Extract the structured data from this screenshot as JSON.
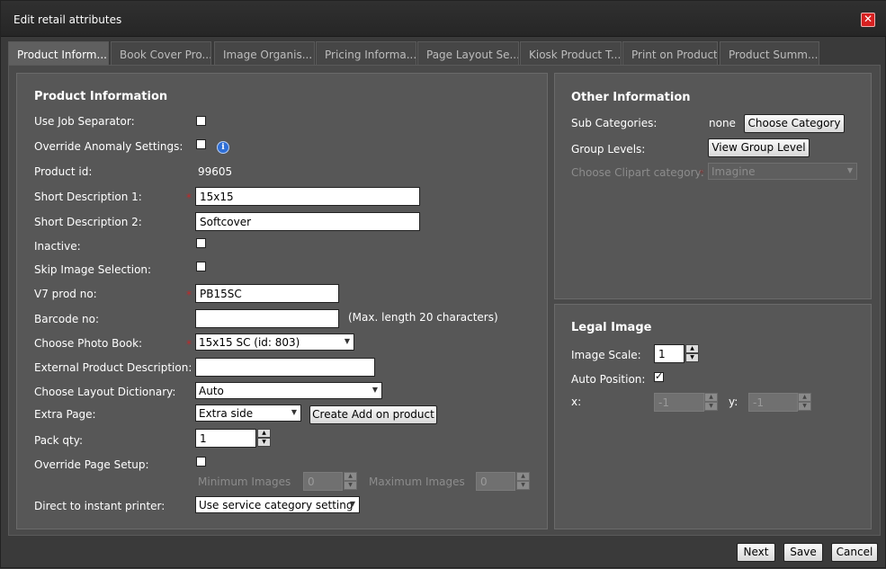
{
  "dialog": {
    "title": "Edit retail attributes"
  },
  "tabs": [
    "Product Inform...",
    "Book Cover Pro...",
    "Image Organis...",
    "Pricing Informa...",
    "Page Layout Se...",
    "Kiosk Product T...",
    "Print on Product",
    "Product Summ..."
  ],
  "product": {
    "heading": "Product Information",
    "use_job_separator": {
      "label": "Use Job Separator:",
      "checked": false
    },
    "override_anomaly": {
      "label": "Override Anomaly Settings:",
      "checked": false
    },
    "product_id": {
      "label": "Product id:",
      "value": "99605"
    },
    "short_desc_1": {
      "label": "Short Description 1:",
      "value": "15x15"
    },
    "short_desc_2": {
      "label": "Short Description 2:",
      "value": "Softcover"
    },
    "inactive": {
      "label": "Inactive:",
      "checked": false
    },
    "skip_image": {
      "label": "Skip Image Selection:",
      "checked": false
    },
    "v7_prod": {
      "label": "V7 prod no:",
      "value": "PB15SC"
    },
    "barcode": {
      "label": "Barcode no:",
      "value": "",
      "hint": "(Max. length 20 characters)"
    },
    "photo_book": {
      "label": "Choose Photo Book:",
      "value": "15x15 SC (id: 803)"
    },
    "ext_desc": {
      "label": "External Product Description:",
      "value": ""
    },
    "layout_dict": {
      "label": "Choose Layout Dictionary:",
      "value": "Auto"
    },
    "extra_page": {
      "label": "Extra Page:",
      "value": "Extra side",
      "button": "Create Add on product"
    },
    "pack_qty": {
      "label": "Pack qty:",
      "value": "1"
    },
    "override_page": {
      "label": "Override Page Setup:",
      "checked": false
    },
    "min_images": {
      "label": "Minimum Images",
      "value": "0"
    },
    "max_images": {
      "label": "Maximum Images",
      "value": "0"
    },
    "instant_printer": {
      "label": "Direct to instant printer:",
      "value": "Use service category setting"
    }
  },
  "other": {
    "heading": "Other Information",
    "sub_categories": {
      "label": "Sub Categories:",
      "value": "none",
      "button": "Choose Category"
    },
    "group_levels": {
      "label": "Group Levels:",
      "button": "View Group Level"
    },
    "clipart": {
      "label": "Choose Clipart category:",
      "value": "Imagine"
    }
  },
  "legal": {
    "heading": "Legal Image",
    "scale": {
      "label": "Image Scale:",
      "value": "1"
    },
    "auto_position": {
      "label": "Auto Position:",
      "checked": true
    },
    "x": {
      "label": "x:",
      "value": "-1"
    },
    "y": {
      "label": "y:",
      "value": "-1"
    }
  },
  "footer": {
    "next": "Next",
    "save": "Save",
    "cancel": "Cancel"
  },
  "colors": {
    "required_marker": "#c0282a",
    "close": "#d72020",
    "info": "#2f6fd6"
  }
}
